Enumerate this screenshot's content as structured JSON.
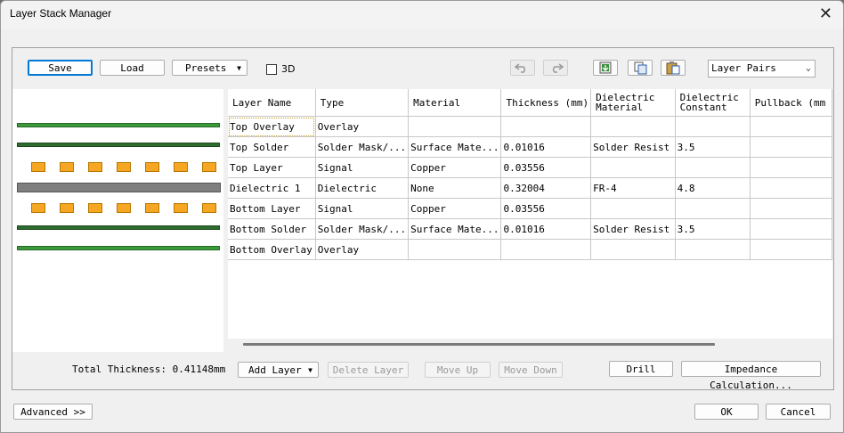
{
  "window": {
    "title": "Layer Stack Manager",
    "close_glyph": "✕"
  },
  "toolbar": {
    "save_label": "Save",
    "load_label": "Load",
    "presets_label": "Presets",
    "checkbox_3d_label": "3D",
    "checkbox_3d_checked": false,
    "layer_pairs_value": "Layer Pairs",
    "icons": [
      "undo-icon",
      "redo-icon",
      "import-icon",
      "copy-icon",
      "paste-icon"
    ]
  },
  "preview": {
    "total_thickness_label": "Total Thickness: 0.41148mm",
    "colors": {
      "overlay": "#3c9a3c",
      "solder": "#2e6b2e",
      "copper": "#f5a623",
      "dielectric": "#7f7f7f"
    }
  },
  "table": {
    "columns": [
      "Layer Name",
      "Type",
      "Material",
      "Thickness (mm)",
      "Dielectric Material",
      "Dielectric Constant",
      "Pullback (mm"
    ],
    "rows": [
      [
        "Top Overlay",
        "Overlay",
        "",
        "",
        "",
        "",
        ""
      ],
      [
        "Top Solder",
        "Solder Mask/...",
        "Surface Mate...",
        "0.01016",
        "Solder Resist",
        "3.5",
        ""
      ],
      [
        "Top Layer",
        "Signal",
        "Copper",
        "0.03556",
        "",
        "",
        ""
      ],
      [
        "Dielectric 1",
        "Dielectric",
        "None",
        "0.32004",
        "FR-4",
        "4.8",
        ""
      ],
      [
        "Bottom Layer",
        "Signal",
        "Copper",
        "0.03556",
        "",
        "",
        ""
      ],
      [
        "Bottom Solder",
        "Solder Mask/...",
        "Surface Mate...",
        "0.01016",
        "Solder Resist",
        "3.5",
        ""
      ],
      [
        "Bottom Overlay",
        "Overlay",
        "",
        "",
        "",
        "",
        ""
      ]
    ]
  },
  "actions": {
    "add_layer_label": "Add Layer",
    "delete_layer_label": "Delete Layer",
    "move_up_label": "Move Up",
    "move_down_label": "Move Down",
    "drill_label": "Drill",
    "impedance_label": "Impedance Calculation..."
  },
  "footer": {
    "advanced_label": "Advanced >>",
    "ok_label": "OK",
    "cancel_label": "Cancel"
  }
}
